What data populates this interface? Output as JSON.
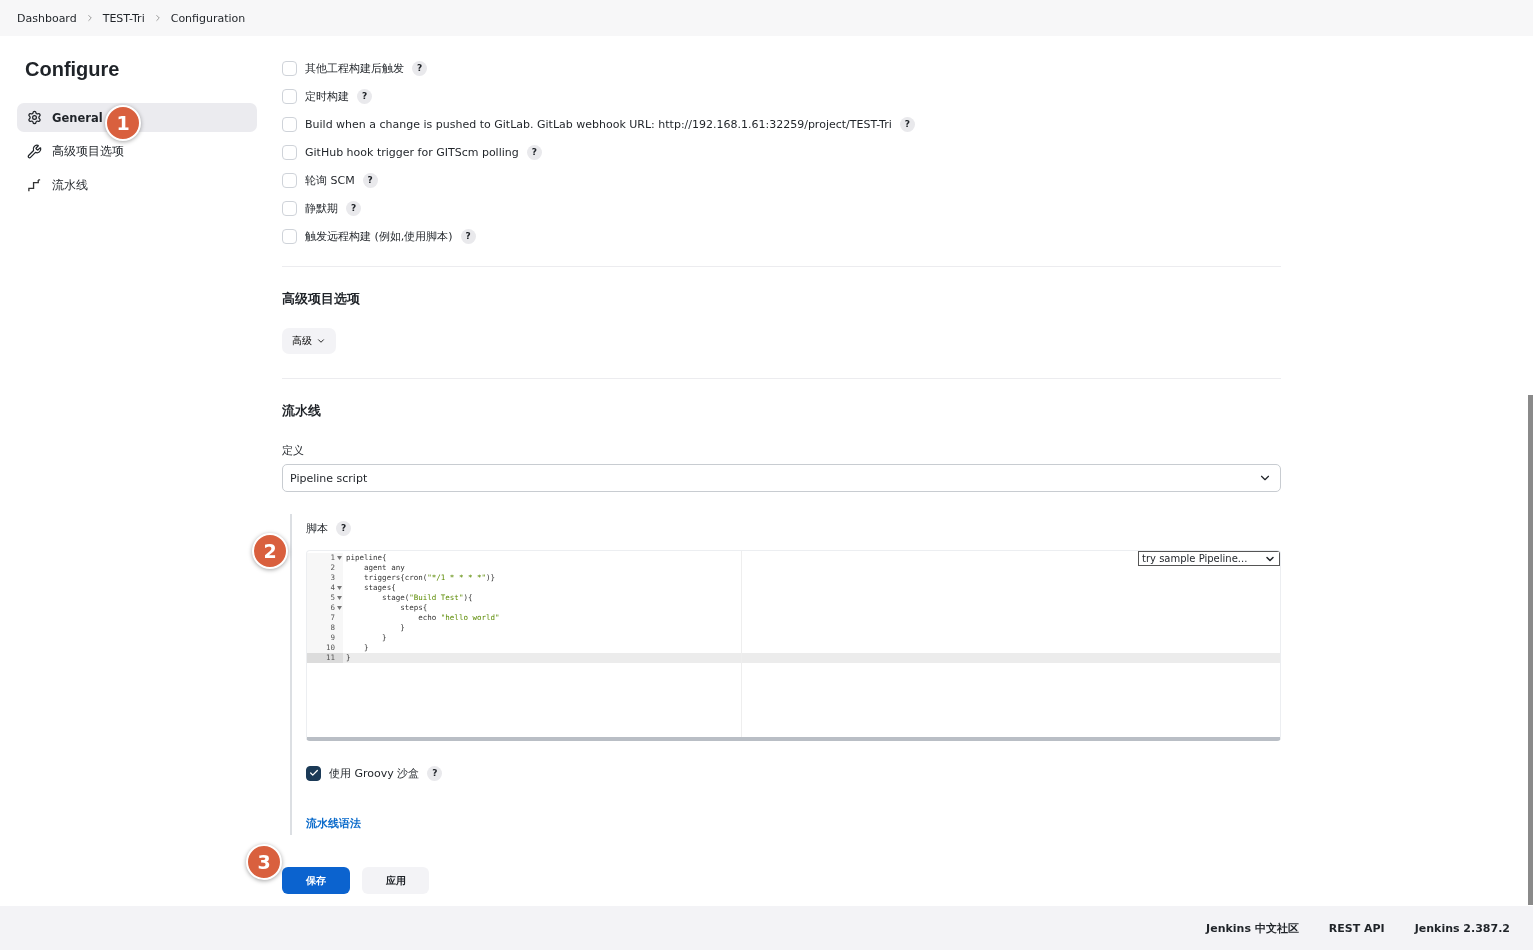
{
  "breadcrumbs": [
    {
      "label": "Dashboard"
    },
    {
      "label": "TEST-Tri"
    },
    {
      "label": "Configuration"
    }
  ],
  "sidebar": {
    "title": "Configure",
    "items": [
      {
        "label": "General",
        "selected": true
      },
      {
        "label": "高级项目选项",
        "selected": false
      },
      {
        "label": "流水线",
        "selected": false
      }
    ]
  },
  "triggers": [
    {
      "label": "其他工程构建后触发",
      "checked": false,
      "help": "?"
    },
    {
      "label": "定时构建",
      "checked": false,
      "help": "?"
    },
    {
      "label": "Build when a change is pushed to GitLab. GitLab webhook URL: http://192.168.1.61:32259/project/TEST-Tri",
      "checked": false,
      "help": "?"
    },
    {
      "label": "GitHub hook trigger for GITScm polling",
      "checked": false,
      "help": "?"
    },
    {
      "label": "轮询 SCM",
      "checked": false,
      "help": "?"
    },
    {
      "label": "静默期",
      "checked": false,
      "help": "?"
    },
    {
      "label": "触发远程构建 (例如,使用脚本)",
      "checked": false,
      "help": "?"
    }
  ],
  "advanced": {
    "title": "高级项目选项",
    "button": "高级"
  },
  "pipeline": {
    "title": "流水线",
    "definition_label": "定义",
    "definition": "Pipeline script",
    "script_label": "脚本",
    "script_help": "?",
    "sample_select": "try sample Pipeline...",
    "code": [
      {
        "number": "1",
        "fold": true,
        "selected": false,
        "parts": [
          {
            "kind": "plain",
            "text": "pipeline{"
          }
        ]
      },
      {
        "number": "2",
        "fold": false,
        "selected": false,
        "parts": [
          {
            "kind": "plain",
            "text": "    agent any"
          }
        ]
      },
      {
        "number": "3",
        "fold": false,
        "selected": false,
        "parts": [
          {
            "kind": "plain",
            "text": "    triggers{cron("
          },
          {
            "kind": "string",
            "text": "\"*/1 * * * *\""
          },
          {
            "kind": "plain",
            "text": ")}"
          }
        ]
      },
      {
        "number": "4",
        "fold": true,
        "selected": false,
        "parts": [
          {
            "kind": "plain",
            "text": "    stages{"
          }
        ]
      },
      {
        "number": "5",
        "fold": true,
        "selected": false,
        "parts": [
          {
            "kind": "plain",
            "text": "        stage("
          },
          {
            "kind": "string",
            "text": "\"Build Test\""
          },
          {
            "kind": "plain",
            "text": "){"
          }
        ]
      },
      {
        "number": "6",
        "fold": true,
        "selected": false,
        "parts": [
          {
            "kind": "plain",
            "text": "            steps{"
          }
        ]
      },
      {
        "number": "7",
        "fold": false,
        "selected": false,
        "parts": [
          {
            "kind": "plain",
            "text": "                echo "
          },
          {
            "kind": "string",
            "text": "\"hello world\""
          }
        ]
      },
      {
        "number": "8",
        "fold": false,
        "selected": false,
        "parts": [
          {
            "kind": "plain",
            "text": "            }"
          }
        ]
      },
      {
        "number": "9",
        "fold": false,
        "selected": false,
        "parts": [
          {
            "kind": "plain",
            "text": "        }"
          }
        ]
      },
      {
        "number": "10",
        "fold": false,
        "selected": false,
        "parts": [
          {
            "kind": "plain",
            "text": "    }"
          }
        ]
      },
      {
        "number": "11",
        "fold": false,
        "selected": true,
        "parts": [
          {
            "kind": "plain",
            "text": "}"
          }
        ]
      }
    ],
    "sandbox": {
      "label": "使用 Groovy 沙盒",
      "checked": true,
      "help": "?"
    },
    "syntax_link": "流水线语法"
  },
  "buttons": [
    {
      "label": "保存",
      "kind": "primary"
    },
    {
      "label": "应用",
      "kind": "secondary"
    }
  ],
  "callouts": [
    {
      "label": "1"
    },
    {
      "label": "2"
    },
    {
      "label": "3"
    }
  ],
  "footer": [
    {
      "label": "Jenkins 中文社区"
    },
    {
      "label": "REST API"
    },
    {
      "label": "Jenkins 2.387.2"
    }
  ]
}
